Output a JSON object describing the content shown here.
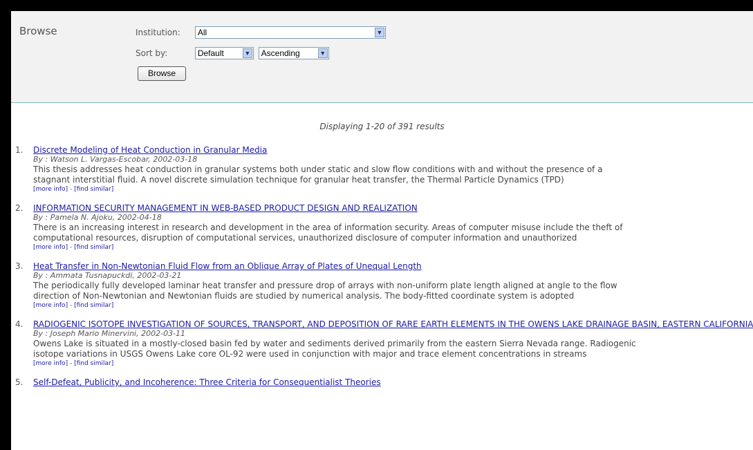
{
  "browse": {
    "title": "Browse",
    "institution_label": "Institution:",
    "institution_value": "All",
    "sortby_label": "Sort by:",
    "sort_field_value": "Default",
    "sort_order_value": "Ascending",
    "button_label": "Browse"
  },
  "summary": "Displaying 1-20 of 391 results",
  "links": {
    "more_info": "[more info]",
    "separator": " - ",
    "find_similar": "[find similar]"
  },
  "results": [
    {
      "num": "1.",
      "title": "Discrete Modeling of Heat Conduction in Granular Media",
      "author": "By : Watson L. Vargas-Escobar, 2002-03-18",
      "abstract1": "This thesis addresses heat conduction in granular systems both under static and slow flow conditions with and without the presence of a",
      "abstract2": "stagnant interstitial fluid. A novel discrete simulation technique for granular heat transfer, the Thermal Particle Dynamics (TPD)"
    },
    {
      "num": "2.",
      "title": "INFORMATION SECURITY MANAGEMENT IN WEB-BASED PRODUCT DESIGN AND REALIZATION",
      "author": "By : Pamela N. Ajoku, 2002-04-18",
      "abstract1": "There is an increasing interest in research and development in the area of information security. Areas of computer misuse include the theft of",
      "abstract2": "computational resources, disruption of computational services, unauthorized disclosure of computer information and unauthorized"
    },
    {
      "num": "3.",
      "title": "Heat Transfer in Non-Newtonian Fluid Flow from an Oblique Array of Plates of Unequal Length",
      "author": "By : Ammata Tusnapuckdi, 2002-03-21",
      "abstract1": "The periodically fully developed laminar heat transfer and pressure drop of arrays with non-uniform plate length aligned at angle to the flow",
      "abstract2": "direction of Non-Newtonian and Newtonian fluids are studied by numerical analysis. The body-fitted coordinate system is adopted"
    },
    {
      "num": "4.",
      "title": "RADIOGENIC ISOTOPE INVESTIGATION OF SOURCES, TRANSPORT, AND DEPOSITION OF RARE EARTH ELEMENTS IN THE OWENS LAKE DRAINAGE BASIN, EASTERN CALIFORNIA",
      "author": "By : Joseph Mario Minervini, 2002-03-11",
      "abstract1": "Owens Lake is situated in a mostly-closed basin fed by water and sediments derived primarily from the eastern Sierra Nevada range. Radiogenic",
      "abstract2": "isotope variations in USGS Owens Lake core OL-92 were used in conjunction with major and trace element concentrations in streams"
    },
    {
      "num": "5.",
      "title": "Self-Defeat, Publicity, and Incoherence: Three Criteria for Consequentialist Theories",
      "author": "",
      "abstract1": "",
      "abstract2": ""
    }
  ]
}
